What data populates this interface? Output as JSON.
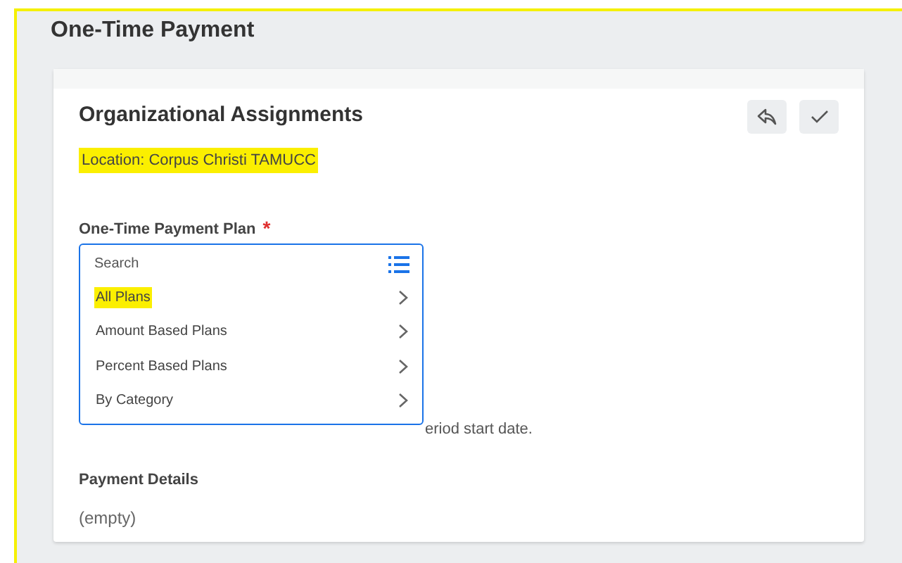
{
  "page": {
    "title": "One-Time Payment"
  },
  "section": {
    "title": "Organizational Assignments",
    "location": {
      "text": "Location: Corpus Christi TAMUCC",
      "highlighted": true
    }
  },
  "plan_field": {
    "label": "One-Time Payment Plan",
    "required_mark": "*",
    "note": "eriod start date.",
    "dropdown": {
      "placeholder": "Search",
      "options": [
        {
          "label": "All Plans",
          "highlighted": true
        },
        {
          "label": "Amount Based Plans",
          "highlighted": false
        },
        {
          "label": "Percent Based Plans",
          "highlighted": false
        },
        {
          "label": "By Category",
          "highlighted": false
        }
      ]
    }
  },
  "payment_details": {
    "label": "Payment Details",
    "value": "(empty)"
  }
}
